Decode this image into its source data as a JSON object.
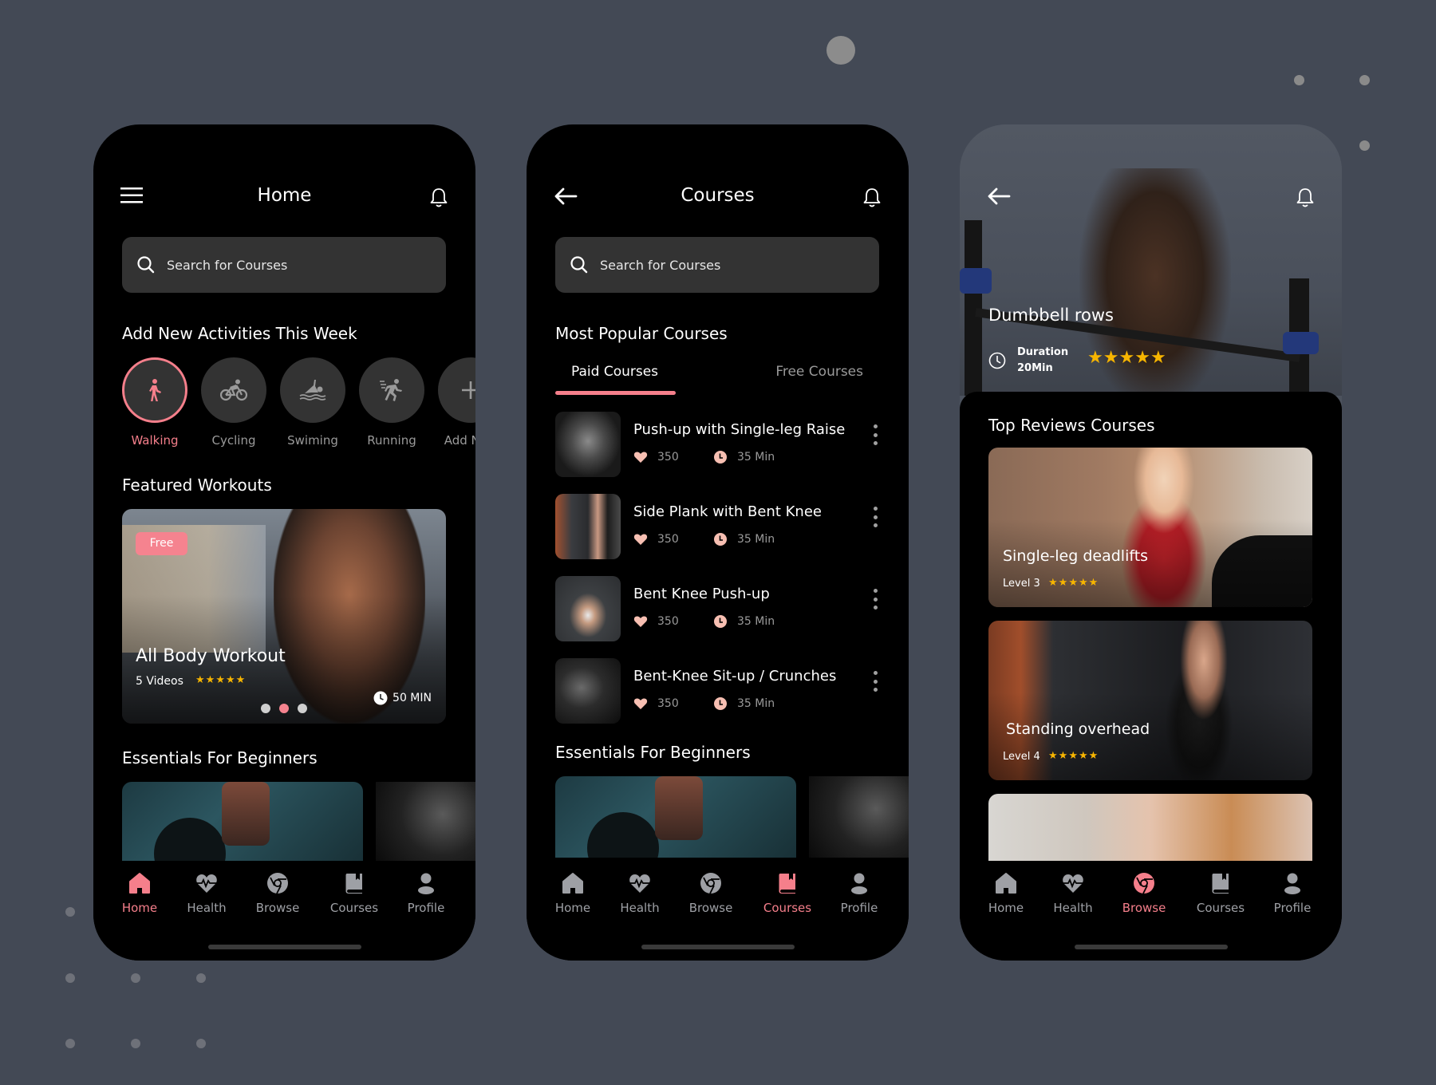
{
  "theme": {
    "accent": "#F57F8B",
    "background": "#434955",
    "surface": "#333333",
    "star": "#F7B500"
  },
  "nav_labels": [
    "Home",
    "Health",
    "Browse",
    "Courses",
    "Profile"
  ],
  "search_placeholder": "Search for Courses",
  "screen_home": {
    "title": "Home",
    "activities_heading": "Add New Activities This Week",
    "activities": [
      {
        "label": "Walking",
        "icon": "walking-icon",
        "active": true
      },
      {
        "label": "Cycling",
        "icon": "cycling-icon",
        "active": false
      },
      {
        "label": "Swiming",
        "icon": "swimming-icon",
        "active": false
      },
      {
        "label": "Running",
        "icon": "running-icon",
        "active": false
      },
      {
        "label": "Add New",
        "icon": "plus-icon",
        "active": false
      }
    ],
    "featured_heading": "Featured Workouts",
    "featured": {
      "badge": "Free",
      "title": "All Body Workout",
      "videos": "5 Videos",
      "rating": 5,
      "duration": "50 MIN",
      "pager_active": 2,
      "pager_total": 3
    },
    "essentials_heading": "Essentials For Beginners",
    "nav_active": "Home"
  },
  "screen_courses": {
    "title": "Courses",
    "popular_heading": "Most Popular Courses",
    "tabs": {
      "paid": "Paid Courses",
      "free": "Free Courses",
      "active": "paid"
    },
    "courses": [
      {
        "name": "Push-up with Single-leg Raise",
        "likes": "350",
        "duration": "35 Min"
      },
      {
        "name": "Side Plank with Bent Knee",
        "likes": "350",
        "duration": "35 Min"
      },
      {
        "name": "Bent Knee Push-up",
        "likes": "350",
        "duration": "35 Min"
      },
      {
        "name": "Bent-Knee Sit-up / Crunches",
        "likes": "350",
        "duration": "35 Min"
      }
    ],
    "essentials_heading": "Essentials For Beginners",
    "nav_active": "Courses"
  },
  "screen_browse": {
    "hero_title": "Dumbbell rows",
    "duration_label": "Duration",
    "duration_value": "20Min",
    "rating": 5,
    "top_reviews_heading": "Top Reviews Courses",
    "reviews": [
      {
        "title": "Single-leg deadlifts",
        "level": "Level 3",
        "rating": 5
      },
      {
        "title": "Standing overhead",
        "level": "Level 4",
        "rating": 5
      }
    ],
    "nav_active": "Browse"
  }
}
